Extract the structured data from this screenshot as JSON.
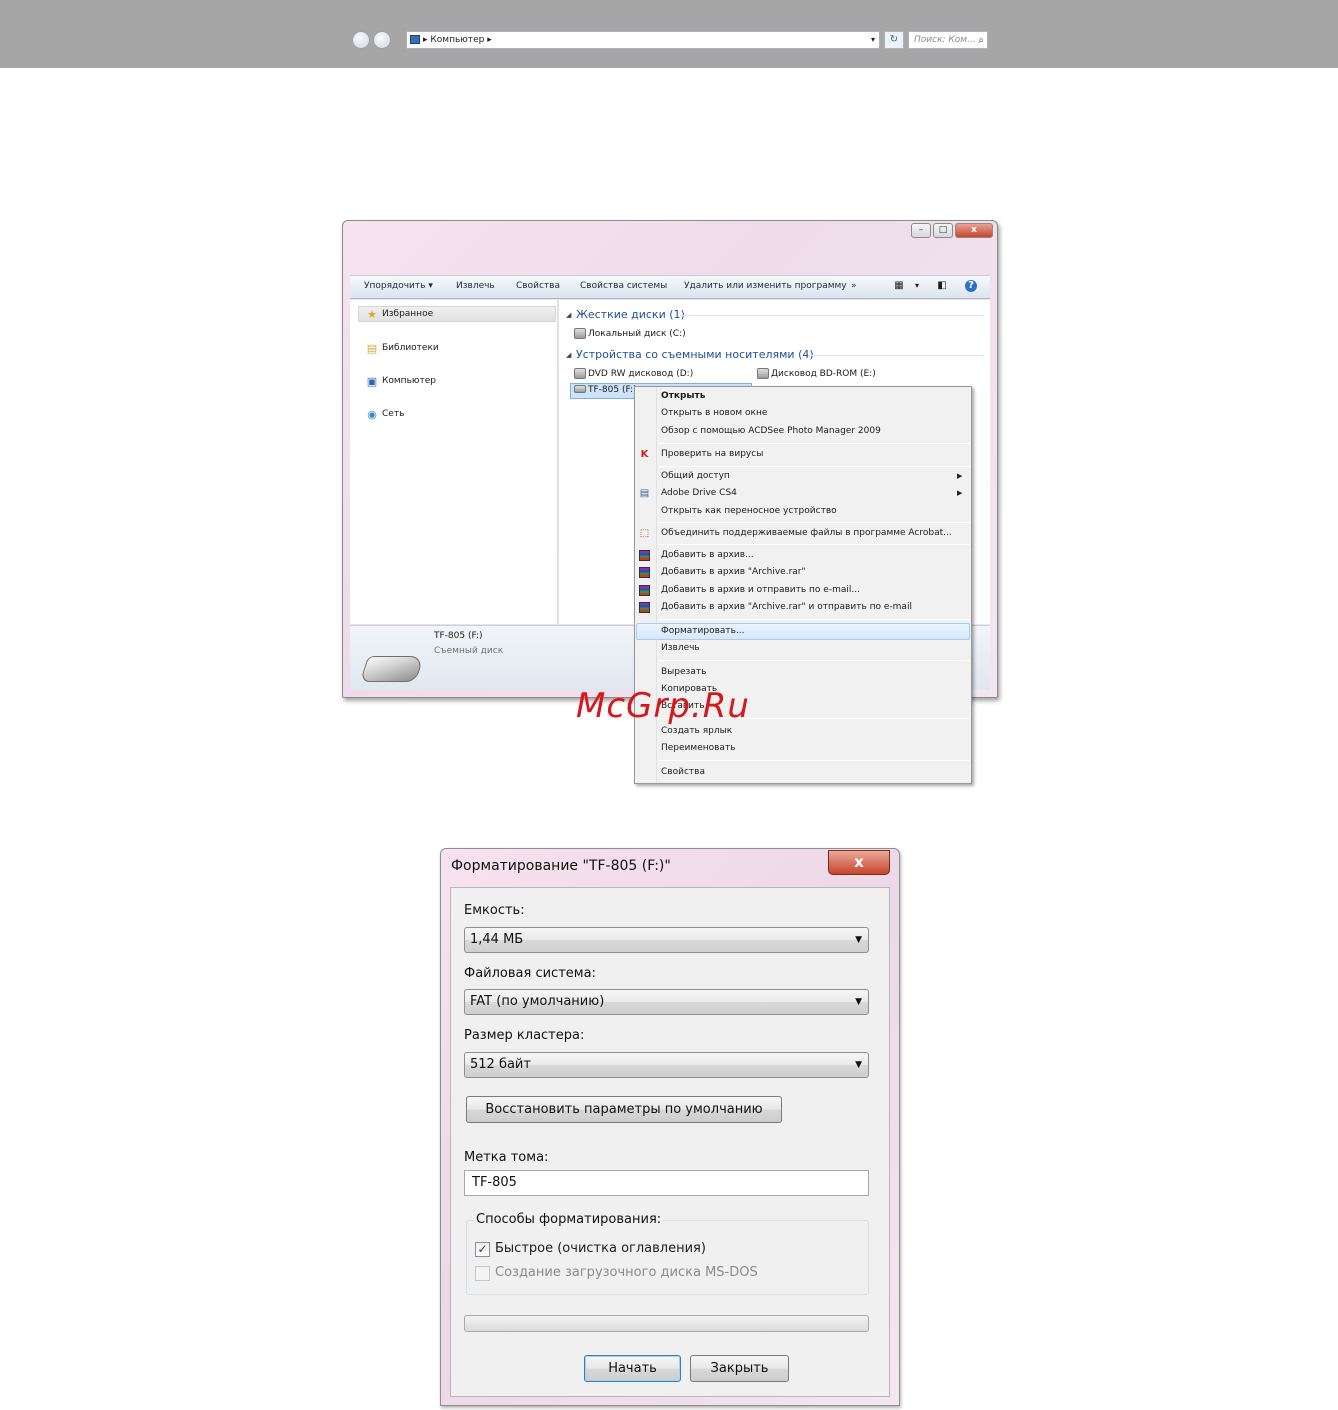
{
  "explorer": {
    "address": "Компьютер",
    "search_placeholder": "Поиск: Ком...",
    "toolbar": {
      "organize": "Упорядочить",
      "eject": "Извлечь",
      "properties": "Свойства",
      "system_properties": "Свойства системы",
      "uninstall": "Удалить или изменить программу",
      "more": "»"
    },
    "nav": {
      "favorites": "Избранное",
      "libraries": "Библиотеки",
      "computer": "Компьютер",
      "network": "Сеть"
    },
    "groups": {
      "hard_disks": "Жесткие диски (1)",
      "removable": "Устройства со съемными носителями (4)"
    },
    "drives": {
      "local_c": "Локальный диск (C:)",
      "dvd_d": "DVD RW дисковод (D:)",
      "bd_e": "Дисковод BD-ROM (E:)",
      "tf_f": "TF-805 (F:)"
    },
    "details": {
      "name": "TF-805 (F:)",
      "type": "Съемный диск"
    }
  },
  "context_menu": {
    "open": "Открыть",
    "open_new_window": "Открыть в новом окне",
    "acdsee": "Обзор с помощью ACDSee Photo Manager 2009",
    "scan": "Проверить на вирусы",
    "share": "Общий доступ",
    "adobe_drive": "Adobe Drive CS4",
    "open_portable": "Открыть как переносное устройство",
    "acrobat": "Объединить поддерживаемые файлы в программе Acrobat...",
    "add_archive": "Добавить в архив...",
    "add_archive_rar": "Добавить в архив \"Archive.rar\"",
    "add_archive_email": "Добавить в архив и отправить по e-mail...",
    "add_archive_rar_email": "Добавить в архив \"Archive.rar\" и отправить по e-mail",
    "format": "Форматировать...",
    "eject": "Извлечь",
    "cut": "Вырезать",
    "copy": "Копировать",
    "paste": "Вставить",
    "create_shortcut": "Создать ярлык",
    "rename": "Переименовать",
    "properties": "Свойства"
  },
  "watermark": "McGrp.Ru",
  "format_dialog": {
    "title": "Форматирование \"TF-805 (F:)\"",
    "capacity_label": "Емкость:",
    "capacity_value": "1,44 МБ",
    "fs_label": "Файловая система:",
    "fs_value": "FAT (по умолчанию)",
    "cluster_label": "Размер кластера:",
    "cluster_value": "512 байт",
    "restore_defaults": "Восстановить параметры по умолчанию",
    "volume_label_label": "Метка тома:",
    "volume_label_value": "TF-805",
    "options_label": "Способы форматирования:",
    "quick_format": "Быстрое (очистка оглавления)",
    "quick_format_checked": true,
    "msdos_boot": "Создание загрузочного диска MS-DOS",
    "msdos_boot_checked": false,
    "progress": 0,
    "start": "Начать",
    "close": "Закрыть"
  },
  "colors": {
    "accent_link": "#1e4e99",
    "watermark": "#d6171c",
    "close_button": "#c8452c"
  }
}
